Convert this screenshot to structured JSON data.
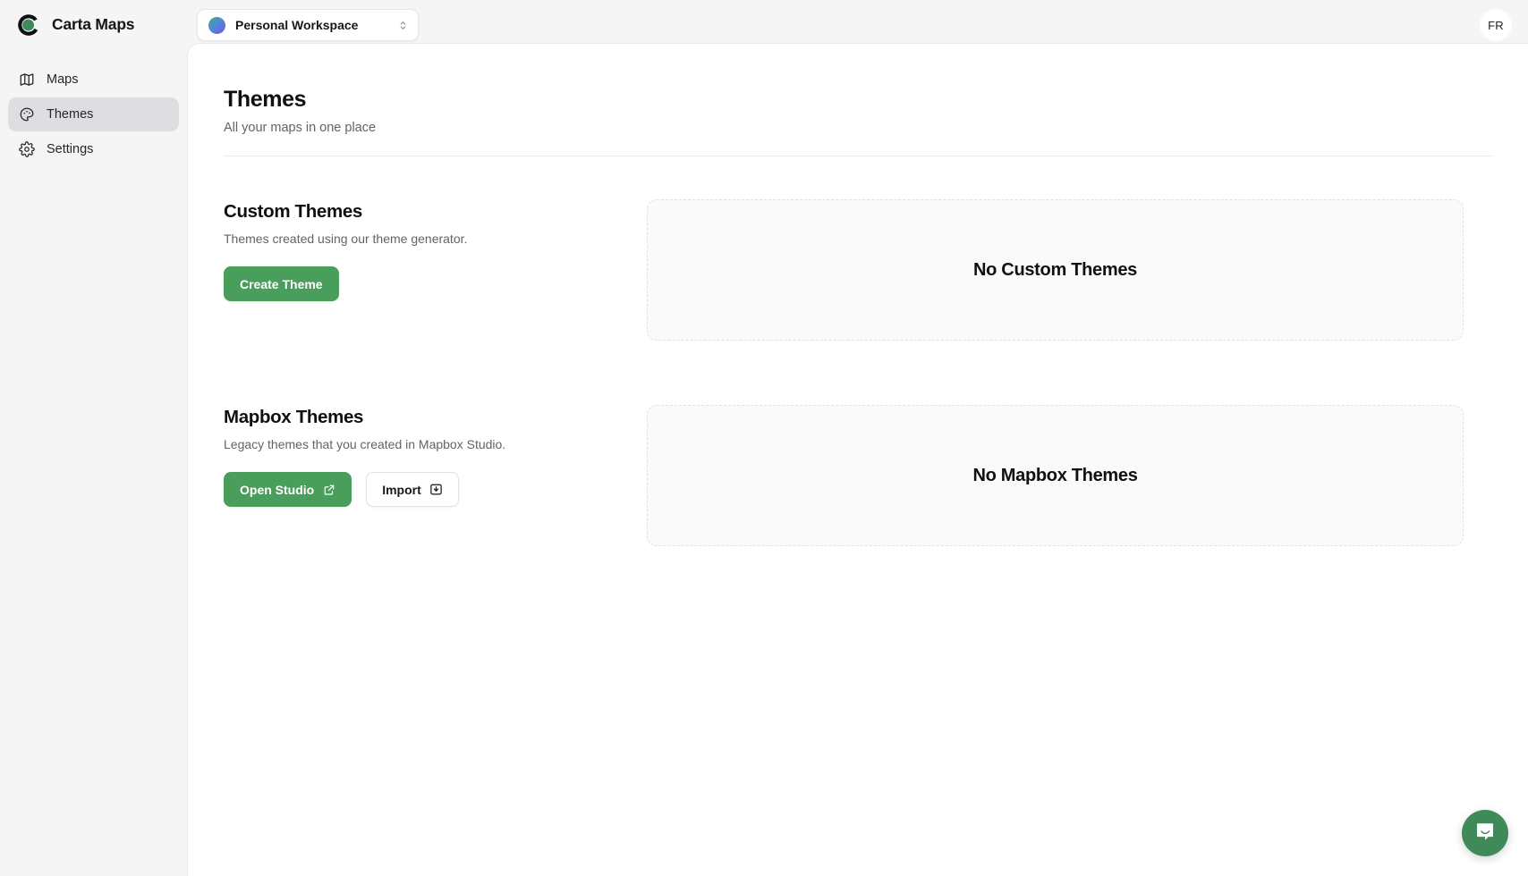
{
  "brand": {
    "name": "Carta Maps",
    "logo_icon": "carta-logo-icon",
    "logo_ring_color": "#101014",
    "logo_leaf_color": "#3f8a58"
  },
  "sidebar": {
    "items": [
      {
        "label": "Maps",
        "icon": "map-icon",
        "active": false
      },
      {
        "label": "Themes",
        "icon": "palette-icon",
        "active": true
      },
      {
        "label": "Settings",
        "icon": "gear-icon",
        "active": false
      }
    ]
  },
  "topbar": {
    "workspace": {
      "label": "Personal Workspace",
      "avatar_icon": "workspace-gradient-avatar",
      "chevron_icon": "chevron-up-down-icon"
    },
    "user": {
      "initials": "FR"
    }
  },
  "page": {
    "title": "Themes",
    "subtitle": "All your maps in one place"
  },
  "sections": {
    "custom": {
      "title": "Custom Themes",
      "description": "Themes created using our theme generator.",
      "create_button": "Create Theme",
      "empty_text": "No Custom Themes"
    },
    "mapbox": {
      "title": "Mapbox Themes",
      "description": "Legacy themes that you created in Mapbox Studio.",
      "open_studio_button": "Open Studio",
      "open_studio_icon": "external-link-icon",
      "import_button": "Import",
      "import_icon": "import-download-icon",
      "empty_text": "No Mapbox Themes"
    }
  },
  "chat": {
    "icon": "chat-bubble-smile-icon",
    "color": "#3f8a58"
  },
  "colors": {
    "primary_green": "#4a9e5c",
    "sidebar_bg": "#f5f5f6",
    "panel_bg": "#ffffff",
    "active_nav_bg": "#dedee1"
  }
}
